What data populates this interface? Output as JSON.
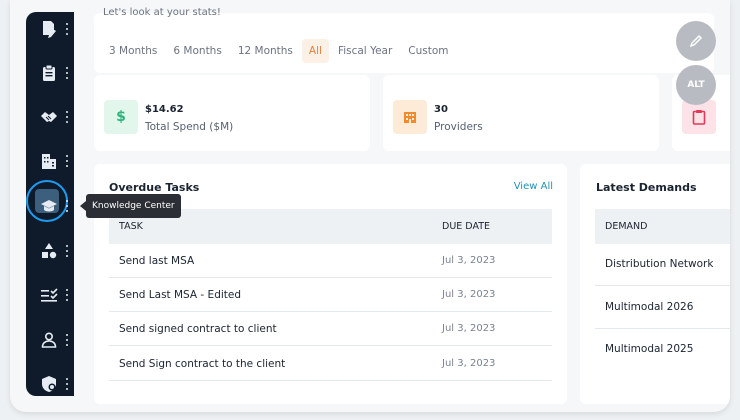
{
  "header": {
    "intro": "Let's look at your stats!"
  },
  "period_tabs": [
    "3 Months",
    "6 Months",
    "12 Months",
    "All",
    "Fiscal Year",
    "Custom"
  ],
  "selected_period": "All",
  "stats": [
    {
      "value": "$14.62",
      "label": "Total Spend ($M)",
      "icon": "dollar-icon",
      "color": "#2fb37a",
      "bg": "#e3f6ec"
    },
    {
      "value": "30",
      "label": "Providers",
      "icon": "building-icon",
      "color": "#f08a2c",
      "bg": "#fdebd8"
    },
    {
      "value": "",
      "label": "",
      "icon": "clipboard-icon",
      "color": "#e2385a",
      "bg": "#fde2e7"
    }
  ],
  "sidebar": {
    "items": [
      {
        "name": "edit-document-icon"
      },
      {
        "name": "clipboard-icon"
      },
      {
        "name": "handshake-icon"
      },
      {
        "name": "buildings-icon"
      },
      {
        "name": "knowledge-center-icon",
        "tooltip": "Knowledge Center"
      },
      {
        "name": "shapes-icon"
      },
      {
        "name": "checklist-icon"
      },
      {
        "name": "user-icon"
      },
      {
        "name": "shield-settings-icon"
      }
    ]
  },
  "overdue": {
    "title": "Overdue Tasks",
    "view_all": "View All",
    "col_task": "TASK",
    "col_date": "DUE DATE",
    "rows": [
      {
        "task": "Send last MSA",
        "date": "Jul 3, 2023"
      },
      {
        "task": "Send Last MSA - Edited",
        "date": "Jul 3, 2023"
      },
      {
        "task": "Send signed contract to client",
        "date": "Jul 3, 2023"
      },
      {
        "task": "Send Sign contract to the client",
        "date": "Jul 3, 2023"
      }
    ]
  },
  "demands": {
    "title": "Latest Demands",
    "col": "DEMAND",
    "rows": [
      "Distribution Network",
      "Multimodal 2026",
      "Multimodal 2025"
    ]
  },
  "fabs": {
    "edit": "pencil-icon",
    "alt": "ALT"
  },
  "colors": {
    "sidebar": "#0f1b2a",
    "accent": "#e8813a",
    "link": "#1f93b2",
    "active_ring": "#1d9bf0"
  }
}
